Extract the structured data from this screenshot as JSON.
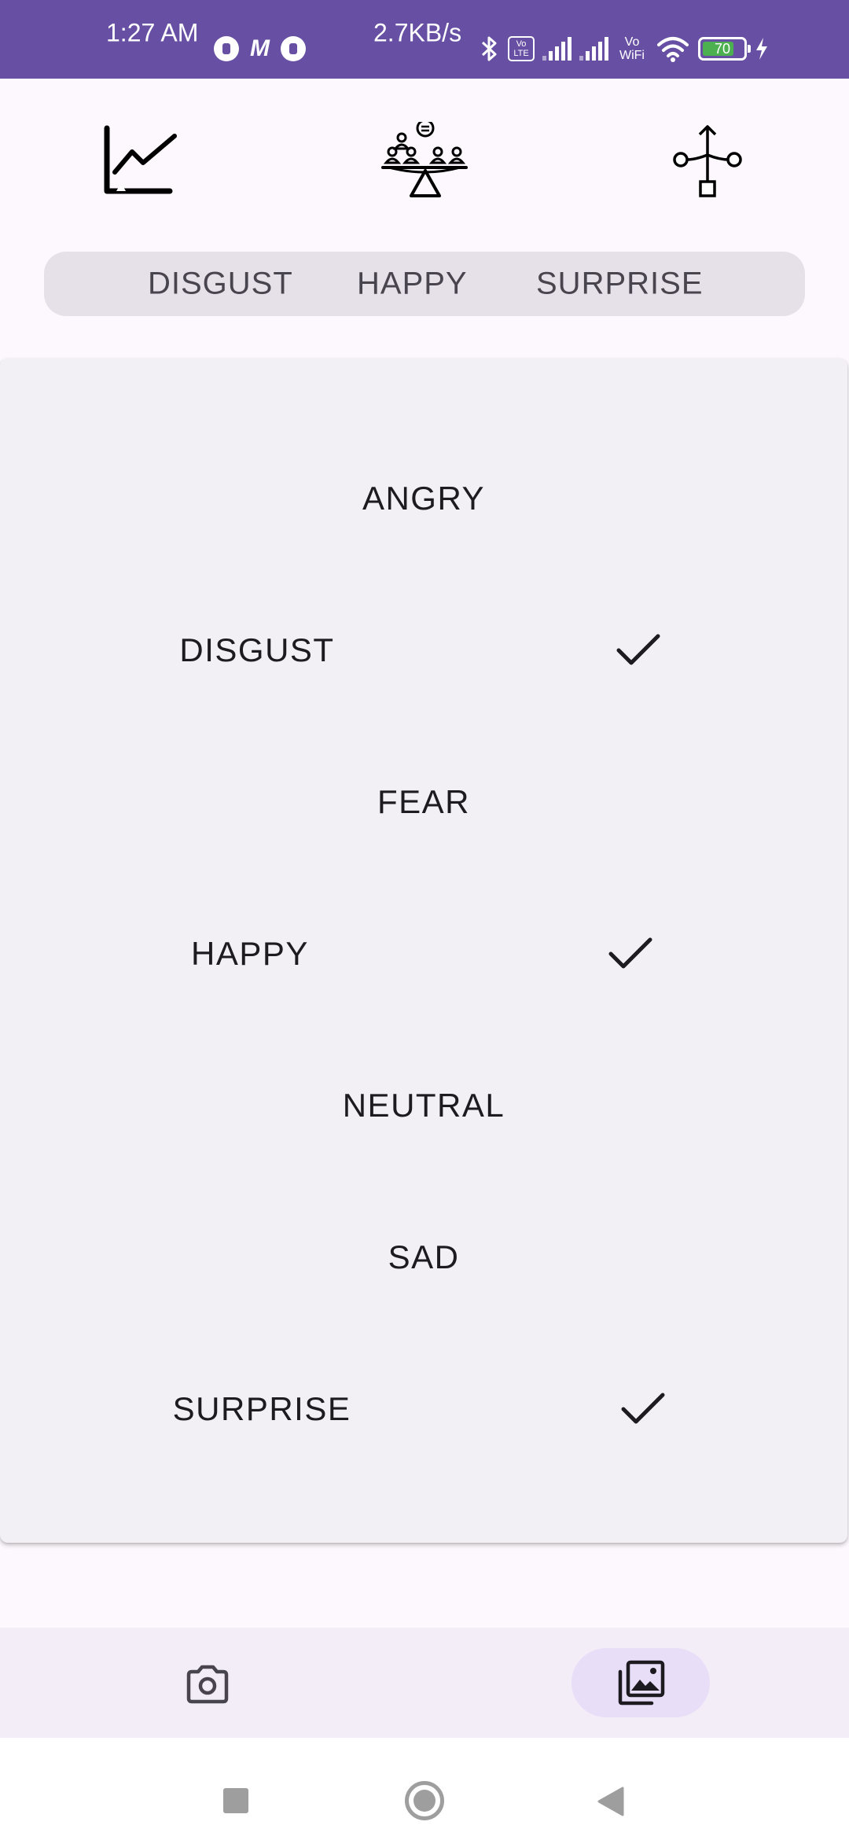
{
  "status_bar": {
    "time": "1:27 AM",
    "network_speed": "2.7KB/s",
    "lte_label": "Vo LTE",
    "vowifi_label": "Vo WiFi",
    "battery_level": "70",
    "bg_color": "#6750a4"
  },
  "toolbar": {
    "icons": [
      "line-chart-icon",
      "balance-scale-group-icon",
      "branch-network-icon"
    ]
  },
  "selected_chips": [
    "DISGUST",
    "HAPPY",
    "SURPRISE"
  ],
  "emotions": [
    {
      "label": "ANGRY",
      "selected": false
    },
    {
      "label": "DISGUST",
      "selected": true
    },
    {
      "label": "FEAR",
      "selected": false
    },
    {
      "label": "HAPPY",
      "selected": true
    },
    {
      "label": "NEUTRAL",
      "selected": false
    },
    {
      "label": "SAD",
      "selected": false
    },
    {
      "label": "SURPRISE",
      "selected": true
    }
  ],
  "bottom_nav": {
    "items": [
      {
        "icon": "camera-icon",
        "active": false
      },
      {
        "icon": "photo-library-icon",
        "active": true
      }
    ],
    "active_color": "#e8def8"
  },
  "system_nav": [
    "recents-button",
    "home-button",
    "back-button"
  ]
}
